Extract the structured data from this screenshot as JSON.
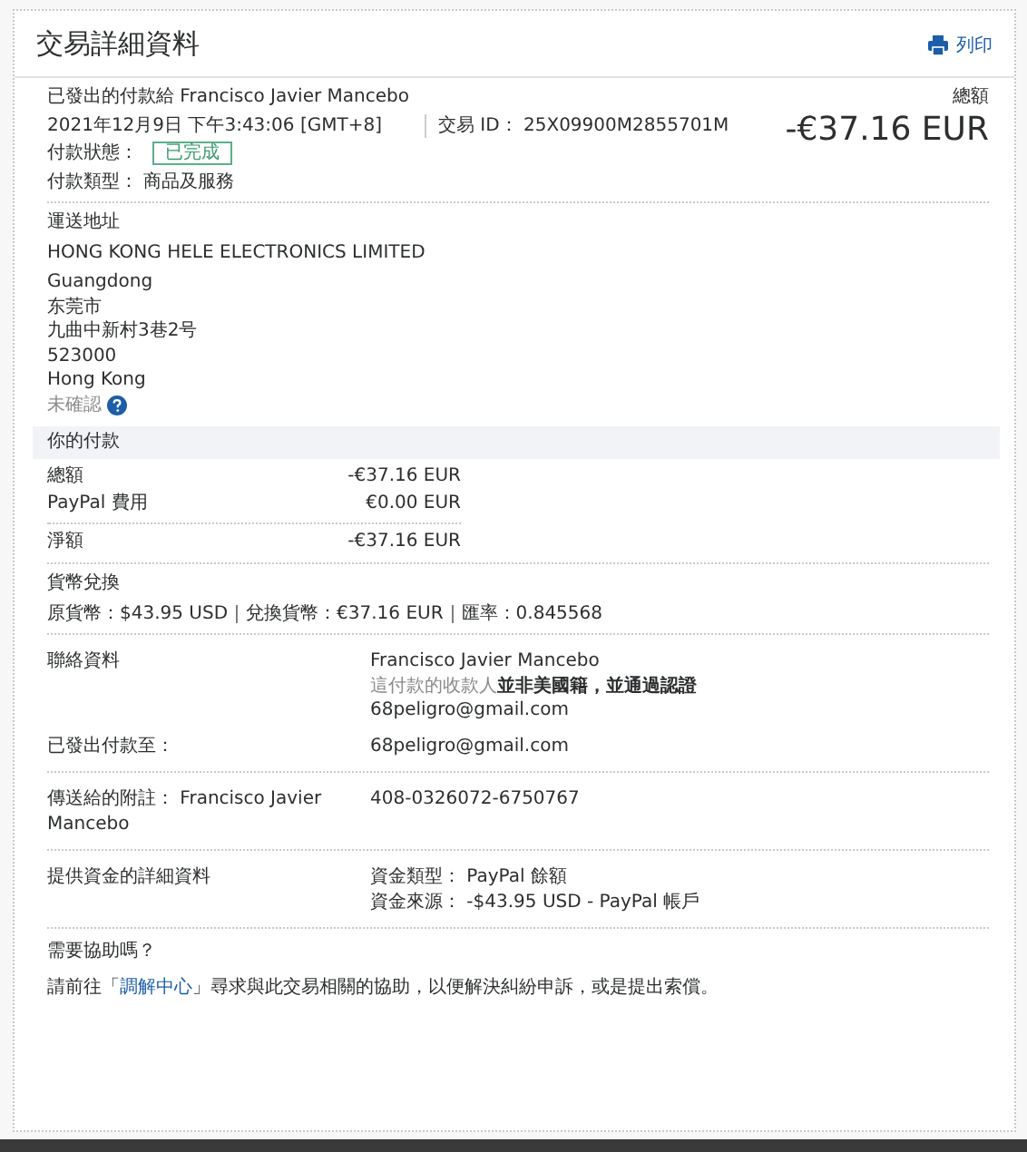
{
  "header": {
    "title": "交易詳細資料",
    "print_label": "列印"
  },
  "summary": {
    "sent_to": "已發出的付款給 Francisco Javier Mancebo",
    "total_label": "總額",
    "date": "2021年12月9日 下午3:43:06 [GMT+8]",
    "transaction_id": "交易 ID： 25X09900M2855701M",
    "amount": "-€37.16 EUR",
    "status_label": "付款狀態：",
    "status": "已完成",
    "type": "付款類型： 商品及服務"
  },
  "shipping": {
    "heading": "運送地址",
    "name": "HONG KONG HELE ELECTRONICS LIMITED",
    "lines": [
      "Guangdong",
      "东莞市",
      "九曲中新村3巷2号",
      "523000",
      "Hong Kong"
    ],
    "unconfirmed": "未確認"
  },
  "payment": {
    "heading": "你的付款",
    "rows": [
      {
        "label": "總額",
        "value": "-€37.16 EUR"
      },
      {
        "label": "PayPal 費用",
        "value": "€0.00 EUR"
      },
      {
        "label": "淨額",
        "value": "-€37.16 EUR"
      }
    ]
  },
  "conversion": {
    "heading": "貨幣兌換",
    "line": "原貨幣：$43.95 USD｜兌換貨幣：€37.16 EUR｜匯率：0.845568"
  },
  "details": [
    {
      "label": "聯絡資料",
      "values": [
        {
          "text": "Francisco Javier Mancebo",
          "kind": "plain"
        },
        {
          "text": "這付款的收款人**並非美國籍，並通過認證**",
          "kind": "note"
        },
        {
          "text": "68peligro@gmail.com",
          "kind": "plain"
        }
      ],
      "divider": true
    },
    {
      "label": "已發出付款至：",
      "values": [
        {
          "text": "68peligro@gmail.com",
          "kind": "plain"
        }
      ],
      "divider": false
    },
    {
      "label": "傳送給的附註： Francisco Javier Mancebo",
      "values": [
        {
          "text": "408-0326072-6750767",
          "kind": "plain"
        }
      ],
      "divider": true
    },
    {
      "label": "提供資金的詳細資料",
      "values": [
        {
          "text": "資金類型： PayPal 餘額",
          "kind": "plain"
        },
        {
          "text": "資金來源： -$43.95 USD  -  PayPal 帳戶",
          "kind": "plain"
        }
      ],
      "divider": true
    }
  ],
  "help": {
    "heading": "需要協助嗎？",
    "before": "請前往「",
    "link": "調解中心",
    "after": "」尋求與此交易相關的協助，以便解決糾紛申訴，或是提出索償。"
  }
}
